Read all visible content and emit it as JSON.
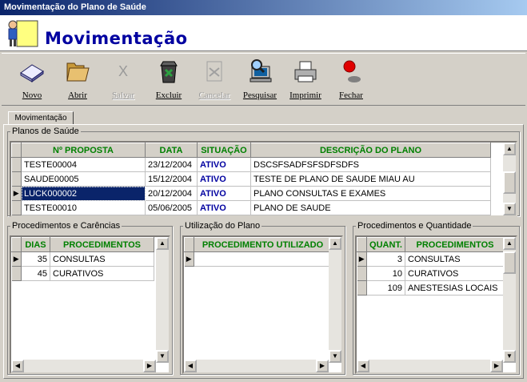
{
  "window": {
    "title": "Movimentação do Plano de Saúde"
  },
  "header": {
    "title": "Movimentação",
    "icon": "person-sign-icon"
  },
  "toolbar": {
    "buttons": [
      {
        "label": "Novo",
        "icon": "new-icon",
        "enabled": true
      },
      {
        "label": "Abrir",
        "icon": "folder-icon",
        "enabled": true
      },
      {
        "label": "Salvar",
        "icon": "x-icon",
        "enabled": false
      },
      {
        "label": "Excluir",
        "icon": "trash-icon",
        "enabled": true
      },
      {
        "label": "Cancelar",
        "icon": "cancel-icon",
        "enabled": false
      },
      {
        "label": "Pesquisar",
        "icon": "search-computer-icon",
        "enabled": true
      },
      {
        "label": "Imprimir",
        "icon": "printer-icon",
        "enabled": true
      },
      {
        "label": "Fechar",
        "icon": "close-light-icon",
        "enabled": true
      }
    ]
  },
  "tabs": [
    {
      "label": "Movimentação"
    }
  ],
  "planos": {
    "legend": "Planos de Saúde",
    "columns": [
      "Nº PROPOSTA",
      "DATA",
      "SITUAÇÃO",
      "DESCRIÇÃO DO PLANO"
    ],
    "rows": [
      {
        "proposta": "TESTE00004",
        "data": "23/12/2004",
        "situacao": "ATIVO",
        "descricao": "DSCSFSADFSFSDFSDFS"
      },
      {
        "proposta": "SAUDE00005",
        "data": "15/12/2004",
        "situacao": "ATIVO",
        "descricao": "TESTE DE PLANO DE SAUDE MIAU AU"
      },
      {
        "proposta": "LUCK000002",
        "data": "20/12/2004",
        "situacao": "ATIVO",
        "descricao": "PLANO CONSULTAS E EXAMES"
      },
      {
        "proposta": "TESTE00010",
        "data": "05/06/2005",
        "situacao": "ATIVO",
        "descricao": "PLANO DE SAUDE"
      }
    ]
  },
  "carencias": {
    "legend": "Procedimentos e Carências",
    "columns": [
      "DIAS",
      "PROCEDIMENTOS"
    ],
    "rows": [
      {
        "dias": "35",
        "procedimento": "CONSULTAS"
      },
      {
        "dias": "45",
        "procedimento": "CURATIVOS"
      }
    ]
  },
  "utilizacao": {
    "legend": "Utilização do Plano",
    "columns": [
      "PROCEDIMENTO UTILIZADO"
    ]
  },
  "quantidade": {
    "legend": "Procedimentos e Quantidade",
    "columns": [
      "QUANT.",
      "PROCEDIMENTOS"
    ],
    "rows": [
      {
        "quant": "3",
        "procedimento": "CONSULTAS"
      },
      {
        "quant": "10",
        "procedimento": "CURATIVOS"
      },
      {
        "quant": "109",
        "procedimento": "ANESTESIAS LOCAIS"
      }
    ]
  }
}
